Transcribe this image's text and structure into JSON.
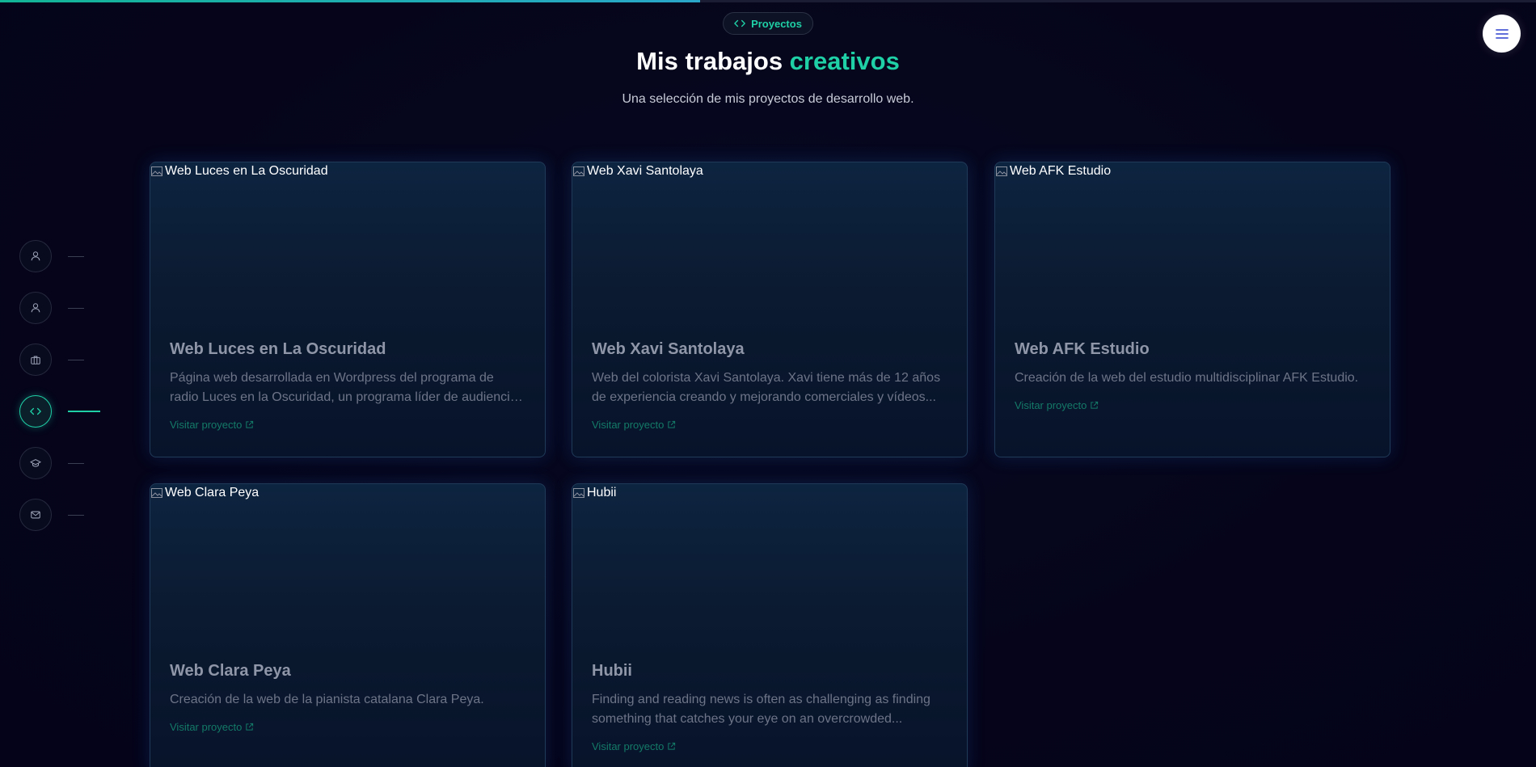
{
  "progress": {
    "fraction": 0.456
  },
  "header": {
    "badge_label": "Proyectos",
    "title_main": "Mis trabajos ",
    "title_accent": "creativos",
    "subtitle": "Una selección de mis proyectos de desarrollo web."
  },
  "menu": {
    "icon": "hamburger-icon"
  },
  "sidebar": {
    "items": [
      {
        "icon": "user-icon",
        "active": false
      },
      {
        "icon": "user-icon",
        "active": false
      },
      {
        "icon": "briefcase-icon",
        "active": false
      },
      {
        "icon": "code-icon",
        "active": true
      },
      {
        "icon": "graduation-cap-icon",
        "active": false
      },
      {
        "icon": "mail-icon",
        "active": false
      }
    ]
  },
  "projects": [
    {
      "image_alt": "Web Luces en La Oscuridad",
      "title": "Web Luces en La Oscuridad",
      "description": "Página web desarrollada en Wordpress del programa de radio Luces en la Oscuridad, un programa líder de audiencia en las...",
      "link": "Visitar proyecto"
    },
    {
      "image_alt": "Web Xavi Santolaya",
      "title": "Web Xavi Santolaya",
      "description": "Web del colorista Xavi Santolaya. Xavi tiene más de 12 años de experiencia creando y mejorando comerciales y vídeos...",
      "link": "Visitar proyecto"
    },
    {
      "image_alt": "Web AFK Estudio",
      "title": "Web AFK Estudio",
      "description": "Creación de la web del estudio multidisciplinar AFK Estudio.",
      "link": "Visitar proyecto"
    },
    {
      "image_alt": "Web Clara Peya",
      "title": "Web Clara Peya",
      "description": "Creación de la web de la pianista catalana Clara Peya.",
      "link": "Visitar proyecto"
    },
    {
      "image_alt": "Hubii",
      "title": "Hubii",
      "description": "Finding and reading news is often as challenging as finding something that catches your eye on an overcrowded...",
      "link": "Visitar proyecto"
    }
  ],
  "colors": {
    "accent": "#1fcfa6",
    "background": "#05051a",
    "card_border": "#1f3a58"
  }
}
